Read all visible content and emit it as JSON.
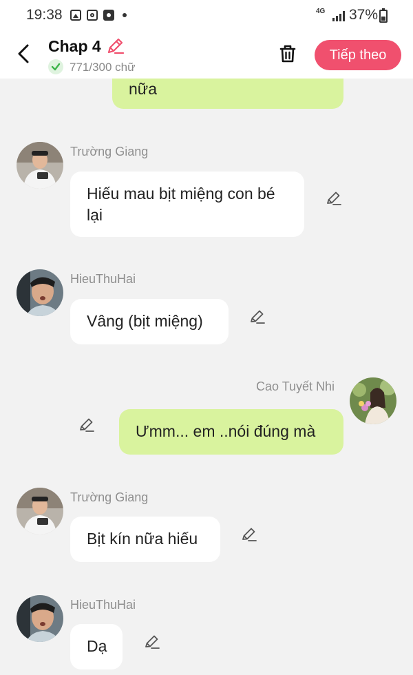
{
  "status_bar": {
    "time": "19:38",
    "network": "4G",
    "battery": "37%"
  },
  "header": {
    "title": "Chap 4",
    "word_count": "771/300 chữ",
    "next_button": "Tiếp theo"
  },
  "colors": {
    "accent": "#f0506e",
    "my_bubble": "#d9f39e",
    "other_bubble": "#ffffff",
    "background": "#f2f2f2"
  },
  "messages": [
    {
      "sender": "",
      "text": "nữa",
      "side": "right"
    },
    {
      "sender": "Trường Giang",
      "text": "Hiếu mau bịt miệng con bé lại",
      "side": "left"
    },
    {
      "sender": "HieuThuHai",
      "text": "Vâng (bịt miệng)",
      "side": "left"
    },
    {
      "sender": "Cao Tuyết Nhi",
      "text": "Ưmm... em ..nói đúng mà",
      "side": "right"
    },
    {
      "sender": "Trường Giang",
      "text": "Bịt kín nữa hiếu",
      "side": "left"
    },
    {
      "sender": "HieuThuHai",
      "text": "Dạ",
      "side": "left"
    }
  ]
}
